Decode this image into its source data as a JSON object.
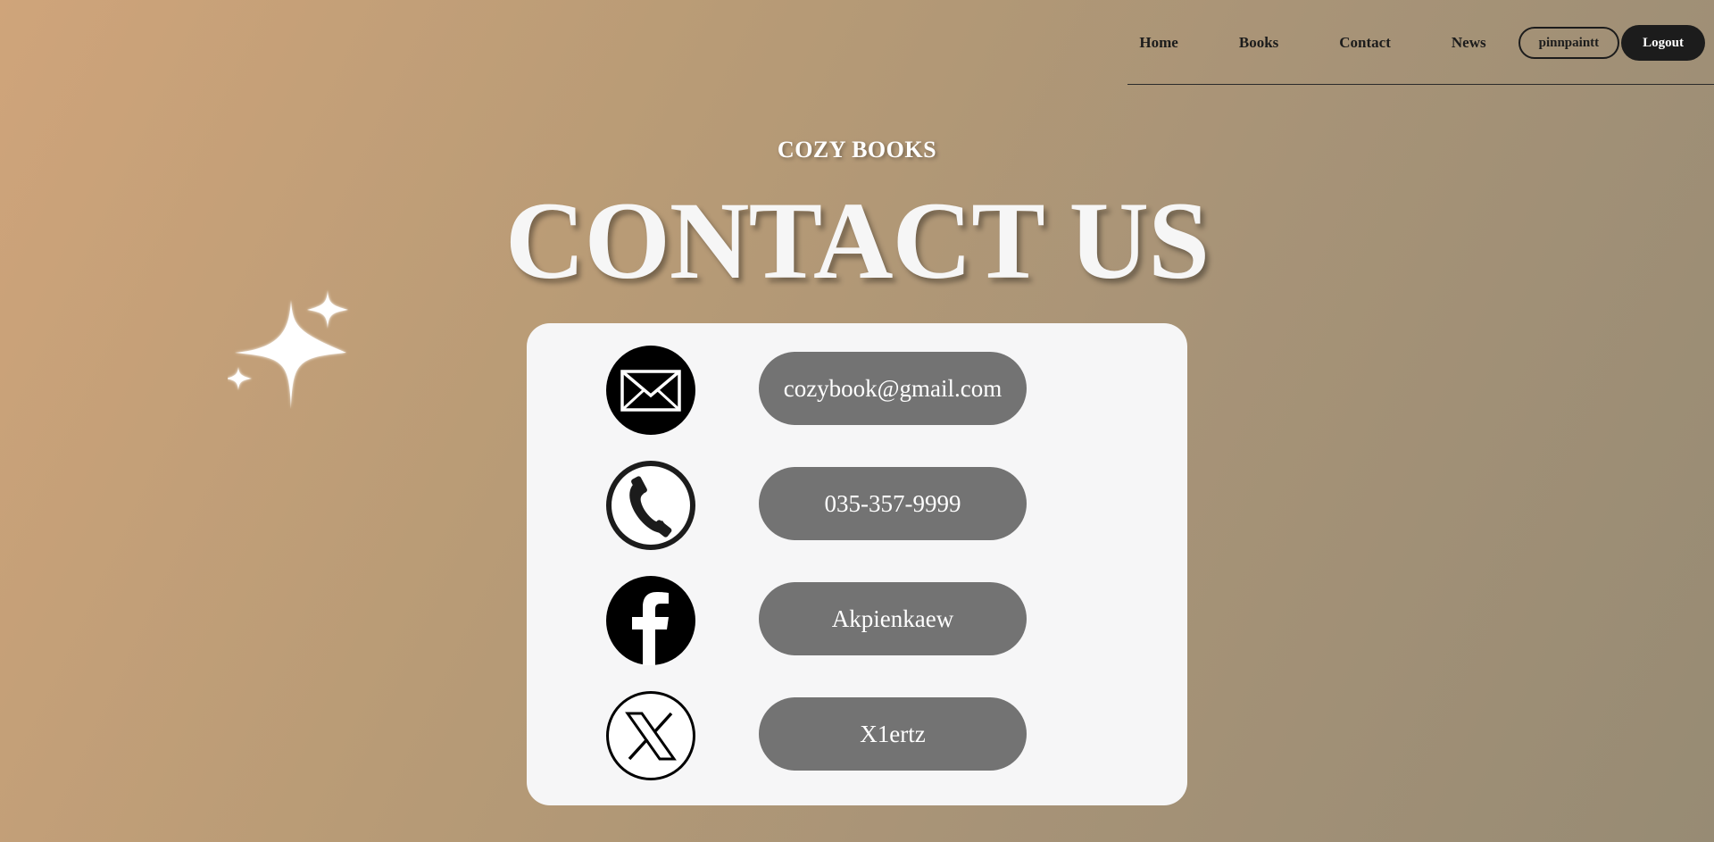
{
  "nav": {
    "links": [
      "Home",
      "Books",
      "Contact",
      "News"
    ],
    "user_label": "pinnpaintt",
    "logout_label": "Logout"
  },
  "header": {
    "brand": "COZY BOOKS",
    "title": "CONTACT US"
  },
  "contacts": [
    {
      "icon": "mail-icon",
      "value": "cozybook@gmail.com"
    },
    {
      "icon": "phone-icon",
      "value": "035-357-9999"
    },
    {
      "icon": "facebook-icon",
      "value": "Akpienkaew"
    },
    {
      "icon": "x-icon",
      "value": "X1ertz"
    }
  ],
  "colors": {
    "pill": "#737373",
    "card": "#f6f6f7",
    "dark": "#1c1c1c"
  }
}
